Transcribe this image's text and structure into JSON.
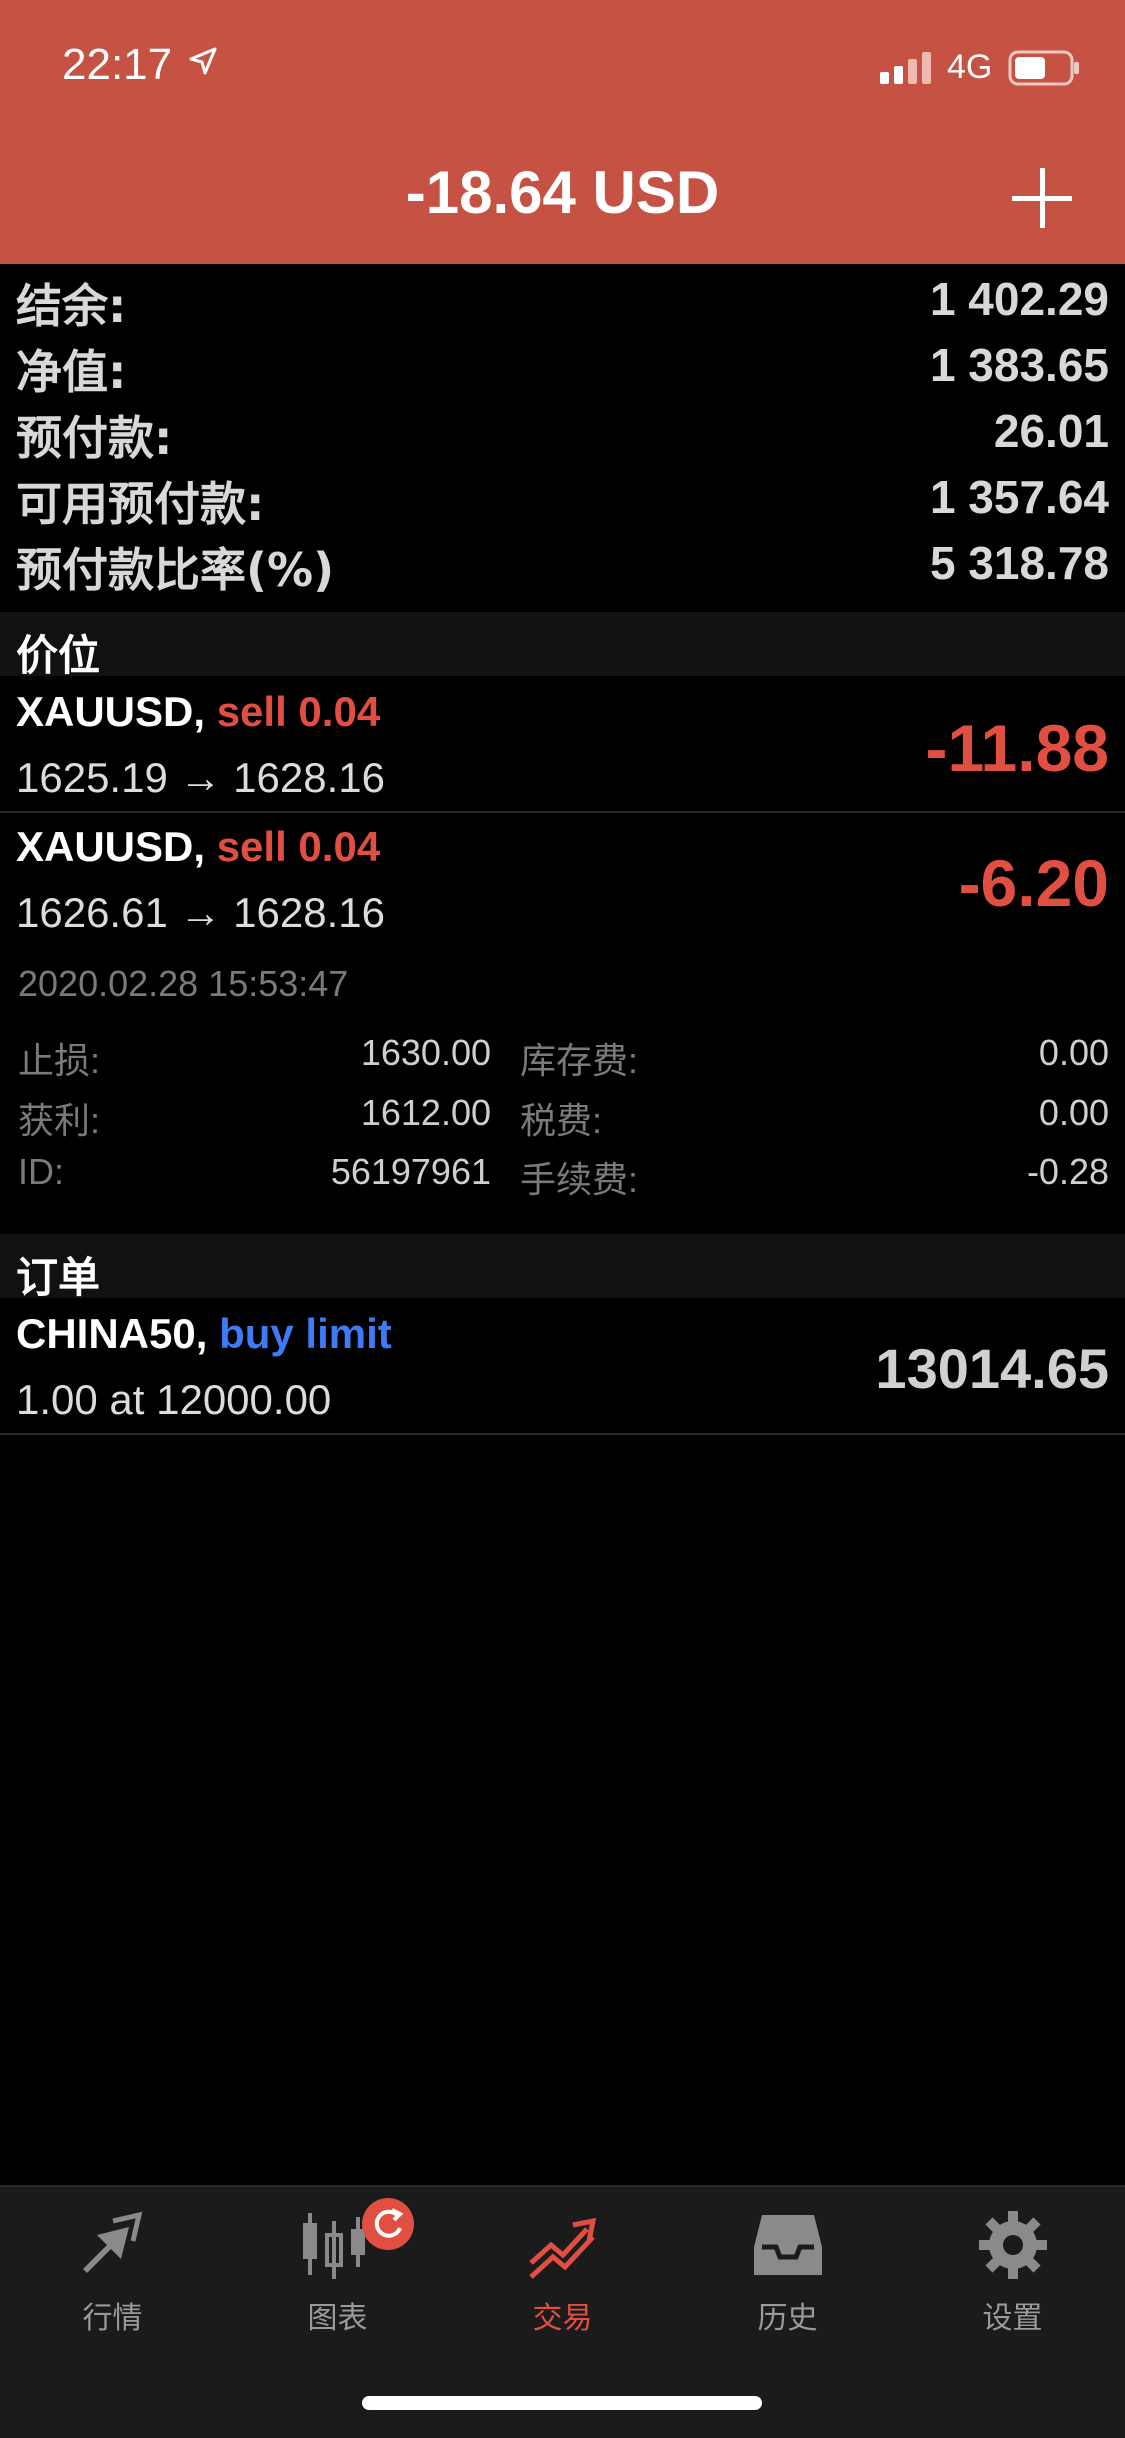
{
  "status_bar": {
    "time": "22:17",
    "network": "4G"
  },
  "header": {
    "title": "-18.64 USD"
  },
  "account": [
    {
      "label": "结余:",
      "value": "1 402.29"
    },
    {
      "label": "净值:",
      "value": "1 383.65"
    },
    {
      "label": "预付款:",
      "value": "26.01"
    },
    {
      "label": "可用预付款:",
      "value": "1 357.64"
    },
    {
      "label": "预付款比率(%)",
      "value": "5 318.78"
    }
  ],
  "positions_section": "价位",
  "positions": [
    {
      "symbol": "XAUUSD,",
      "side": "sell 0.04",
      "prices": "1625.19 → 1628.16",
      "pl": "-11.88"
    },
    {
      "symbol": "XAUUSD,",
      "side": "sell 0.04",
      "prices": "1626.61 → 1628.16",
      "pl": "-6.20"
    }
  ],
  "position_detail": {
    "time": "2020.02.28 15:53:47",
    "sl_label": "止损:",
    "sl_value": "1630.00",
    "tp_label": "获利:",
    "tp_value": "1612.00",
    "id_label": "ID:",
    "id_value": "56197961",
    "swap_label": "库存费:",
    "swap_value": "0.00",
    "tax_label": "税费:",
    "tax_value": "0.00",
    "comm_label": "手续费:",
    "comm_value": "-0.28"
  },
  "orders_section": "订单",
  "orders": [
    {
      "symbol": "CHINA50,",
      "side": "buy limit",
      "detail": "1.00 at 12000.00",
      "price": "13014.65"
    }
  ],
  "tabs": [
    {
      "label": "行情",
      "icon": "quotes-icon"
    },
    {
      "label": "图表",
      "icon": "chart-icon"
    },
    {
      "label": "交易",
      "icon": "trade-icon",
      "active": true
    },
    {
      "label": "历史",
      "icon": "history-icon"
    },
    {
      "label": "设置",
      "icon": "settings-icon"
    }
  ],
  "colors": {
    "header": "#c65244",
    "loss": "#e14f42",
    "buy": "#3e7bf4"
  }
}
